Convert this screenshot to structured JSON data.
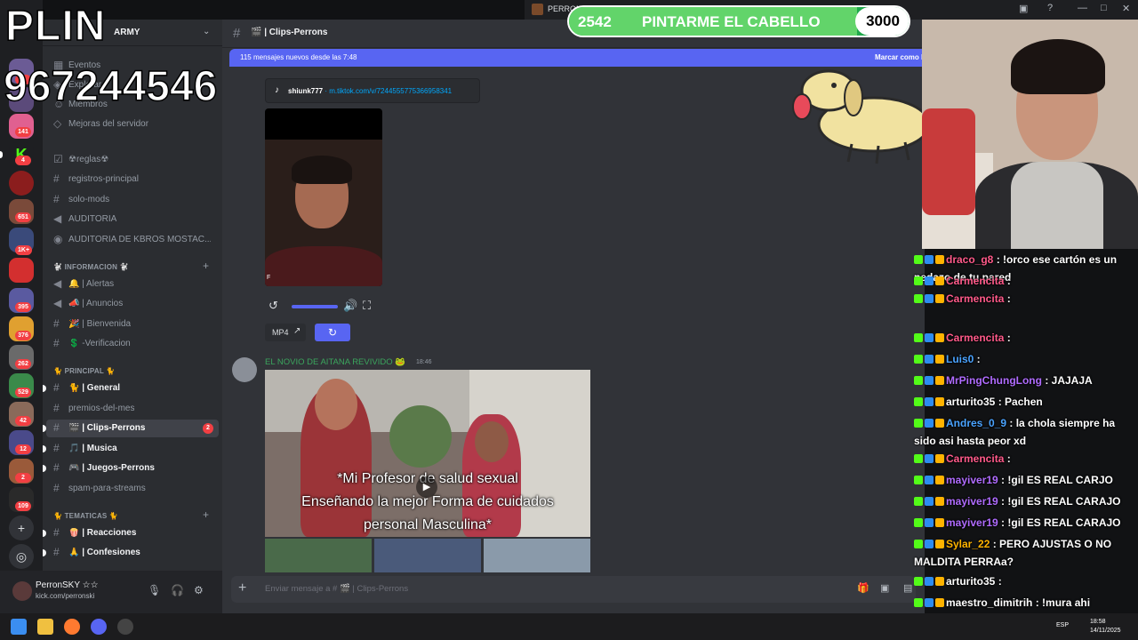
{
  "rail": {
    "badges": [
      "1",
      "141",
      "4",
      "651",
      "1K+",
      "395",
      "376",
      "262",
      "529",
      "42",
      "12",
      "2",
      "109"
    ]
  },
  "server": {
    "name": "ARMY"
  },
  "sidebar": {
    "top_items": [
      {
        "label": "Eventos",
        "icon": "calendar-icon"
      },
      {
        "label": "Explorar",
        "icon": "compass-icon"
      },
      {
        "label": "Miembros",
        "icon": "members-icon"
      },
      {
        "label": "Mejoras del servidor",
        "icon": "boost-icon"
      }
    ],
    "channels_a": [
      "☢reglas☢",
      "registros-principal",
      "solo-mods",
      "AUDITORIA",
      "AUDITORIA DE KBROS MOSTAC..."
    ],
    "cat_informacion": "🐩 INFORMACION 🐩",
    "channels_b": [
      "🔔 | Alertas",
      "📣 | Anuncios",
      "🎉 | Bienvenida",
      "💲 -Verificacion"
    ],
    "cat_principal": "🐈 PRINCIPAL 🐈",
    "channels_c": [
      "🐈 | General",
      "premios-del-mes",
      "🎬 | Clips-Perrons",
      "🎵 | Musica",
      "🎮 | Juegos-Perrons",
      "spam-para-streams"
    ],
    "active_count": "2",
    "cat_tematicas": "🐈 TEMATICAS 🐈",
    "channels_d": [
      "🍿 | Reacciones",
      "🙏 | Confesiones"
    ]
  },
  "user": {
    "name": "PerronSKY ☆☆",
    "status": "kick.com/perronski"
  },
  "chat": {
    "channel": "🎬 | Clips-Perrons",
    "new_messages": "115 mensajes nuevos desde las 7:48",
    "mark_read": "Marcar como leído",
    "embed_author": "shiunk777",
    "embed_url": "m.tiktok.com/v/7244555775366958341",
    "video_watermark": "F",
    "mp4_label": "MP4",
    "msg2_author": "EL NOVIO DE AITANA REVIVIDO 🐸",
    "msg2_time": "18:46",
    "caption_lines": [
      "*Mi Profesor de salud sexual",
      "Enseñando la mejor Forma de cuidados",
      "personal Masculina*"
    ],
    "composer_placeholder": "Enviar mensaje a # 🎬 | Clips-Perrons"
  },
  "window": {
    "title": "PERRON"
  },
  "overlay": {
    "plin": "PLIN",
    "phone": "967244546",
    "goal_current": "2542",
    "goal_label": "PINTARME EL CABELLO",
    "goal_target": "3000",
    "goal_progress": 0.847
  },
  "stream_chat": [
    {
      "name": "draco_g8",
      "text": " : !orco ese cartón es un pedazo de tu pared",
      "color": "#ff5a8a"
    },
    {
      "name": "Carmencita",
      "text": " :",
      "color": "#ff5a8a"
    },
    {
      "name": "Carmencita",
      "text": " :",
      "color": "#ff5a8a"
    },
    {
      "name": "Carmencita",
      "text": " :",
      "color": "#ff5a8a"
    },
    {
      "name": "Luis0",
      "text": " :",
      "color": "#4aa3ff"
    },
    {
      "name": "MrPingChungLong",
      "text": " : JAJAJA",
      "color": "#b06cff"
    },
    {
      "name": "arturito35",
      "text": " : Pachen",
      "color": "#ffffff"
    },
    {
      "name": "Andres_0_9",
      "text": " : la chola siempre ha sido asi hasta peor xd",
      "color": "#4aa3ff"
    },
    {
      "name": "Carmencita",
      "text": " :",
      "color": "#ff5a8a"
    },
    {
      "name": "mayiver19",
      "text": " : !gil ES REAL CARJO",
      "color": "#b06cff"
    },
    {
      "name": "mayiver19",
      "text": " : !gil ES REAL CARAJO",
      "color": "#b06cff"
    },
    {
      "name": "mayiver19",
      "text": " : !gil ES REAL CARAJO",
      "color": "#b06cff"
    },
    {
      "name": "Sylar_22",
      "text": " : PERO AJUSTAS O NO MALDITA PERRAa?",
      "color": "#ffb300"
    },
    {
      "name": "arturito35",
      "text": " :",
      "color": "#ffffff"
    },
    {
      "name": "maestro_dimitrih",
      "text": " : !mura ahi temando el clip enfermodemierda",
      "color": "#ffffff"
    }
  ],
  "taskbar": {
    "lang": "ESP",
    "time": "18:58",
    "date": "14/11/2025"
  },
  "colors": {
    "accent": "#5865f2",
    "kick_green": "#53fc18",
    "goal_green": "#1ea84b"
  }
}
